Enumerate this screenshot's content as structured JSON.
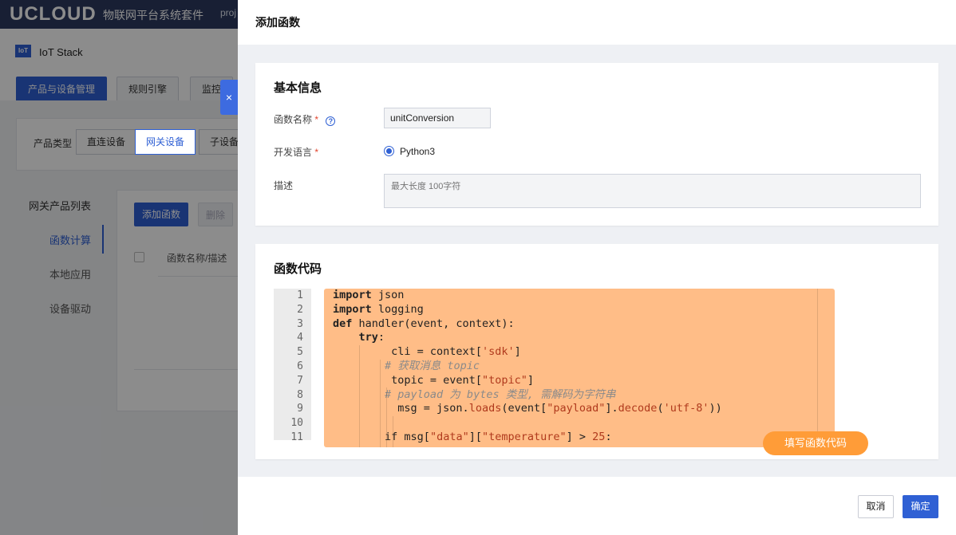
{
  "topbar": {
    "logo": "UCLOUD",
    "suite": "物联网平台系统套件",
    "project": "proj"
  },
  "app": {
    "product_logo": "IoT",
    "product_name": "IoT Stack",
    "tabs": [
      "产品与设备管理",
      "规则引擎",
      "监控"
    ],
    "filter": {
      "label": "产品类型",
      "options": [
        "直连设备",
        "网关设备",
        "子设备"
      ],
      "selected": "网关设备"
    },
    "left_nav": {
      "title": "网关产品列表",
      "items": [
        "函数计算",
        "本地应用",
        "设备驱动"
      ],
      "active": "函数计算"
    },
    "list": {
      "add_button": "添加函数",
      "delete_button": "删除",
      "column_header": "函数名称/描述"
    }
  },
  "drawer": {
    "close_icon": "×",
    "title": "添加函数",
    "basic_info": {
      "title": "基本信息",
      "name_label": "函数名称",
      "required_mark": "*",
      "help_icon": "?",
      "name_value": "unitConversion",
      "lang_label": "开发语言",
      "lang_value": "Python3",
      "desc_label": "描述",
      "desc_placeholder": "最大长度 100字符"
    },
    "code": {
      "title": "函数代码",
      "line_numbers": [
        "1",
        "2",
        "3",
        "4",
        "5",
        "6",
        "7",
        "8",
        "9",
        "10",
        "11"
      ],
      "fold_marks": [
        "",
        "",
        "▾",
        "▾",
        "",
        "",
        "",
        "",
        "",
        "",
        "▾"
      ],
      "lines": [
        {
          "indent": "",
          "parts": [
            {
              "t": "import",
              "c": "kw"
            },
            {
              "t": " json",
              "c": ""
            }
          ]
        },
        {
          "indent": "",
          "parts": [
            {
              "t": "import",
              "c": "kw"
            },
            {
              "t": " logging",
              "c": ""
            }
          ]
        },
        {
          "indent": "",
          "parts": [
            {
              "t": "def",
              "c": "kw"
            },
            {
              "t": " handler(event, context):",
              "c": ""
            }
          ]
        },
        {
          "indent": "    ",
          "parts": [
            {
              "t": "try",
              "c": "kw"
            },
            {
              "t": ":",
              "c": ""
            }
          ]
        },
        {
          "indent": "         ",
          "parts": [
            {
              "t": "cli = context[",
              "c": ""
            },
            {
              "t": "'sdk'",
              "c": "str"
            },
            {
              "t": "]",
              "c": ""
            }
          ]
        },
        {
          "indent": "        ",
          "parts": [
            {
              "t": "# 获取消息 topic",
              "c": "cm"
            }
          ]
        },
        {
          "indent": "         ",
          "parts": [
            {
              "t": "topic = event[",
              "c": ""
            },
            {
              "t": "\"topic\"",
              "c": "str"
            },
            {
              "t": "]",
              "c": ""
            }
          ]
        },
        {
          "indent": "        ",
          "parts": [
            {
              "t": "# payload 为 bytes 类型, 需解码为字符串",
              "c": "cm"
            }
          ]
        },
        {
          "indent": "          ",
          "parts": [
            {
              "t": "msg = json.",
              "c": ""
            },
            {
              "t": "loads",
              "c": "str"
            },
            {
              "t": "(event[",
              "c": ""
            },
            {
              "t": "\"payload\"",
              "c": "str"
            },
            {
              "t": "].",
              "c": ""
            },
            {
              "t": "decode",
              "c": "str"
            },
            {
              "t": "(",
              "c": ""
            },
            {
              "t": "'utf-8'",
              "c": "str"
            },
            {
              "t": "))",
              "c": ""
            }
          ]
        },
        {
          "indent": "",
          "parts": [
            {
              "t": "",
              "c": ""
            }
          ]
        },
        {
          "indent": "        ",
          "parts": [
            {
              "t": "if msg[",
              "c": ""
            },
            {
              "t": "\"data\"",
              "c": "str"
            },
            {
              "t": "][",
              "c": ""
            },
            {
              "t": "\"temperature\"",
              "c": "str"
            },
            {
              "t": "] > ",
              "c": ""
            },
            {
              "t": "25",
              "c": "str"
            },
            {
              "t": ":",
              "c": ""
            }
          ]
        }
      ],
      "hint_pill": "填写函数代码"
    },
    "footer": {
      "cancel": "取消",
      "ok": "确定"
    }
  },
  "colors": {
    "primary": "#2f60d4",
    "topbar": "#2c3a60",
    "code_highlight": "#ffbd87",
    "pill": "#ff9c38"
  }
}
